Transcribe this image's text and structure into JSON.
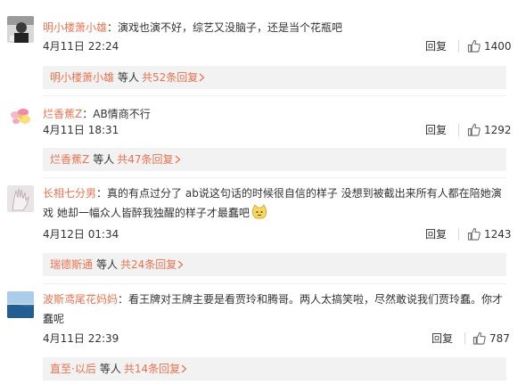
{
  "ui": {
    "reply_label": "回复",
    "others_label": "等人"
  },
  "comments": [
    {
      "avatar": "man-portrait-avatar",
      "username": "明小楼萧小雄",
      "colon": "：",
      "text": "演戏也演不好，综艺又没脑子，还是当个花瓶吧",
      "time": "4月11日 22:24",
      "likes": "1400",
      "sub_user": "明小楼萧小雄",
      "sub_count": "共52条回复"
    },
    {
      "avatar": "flower-avatar",
      "username": "烂香蕉Z",
      "colon": "：",
      "text": "AB情商不行",
      "time": "4月11日 18:31",
      "likes": "1292",
      "sub_user": "烂香蕉Z",
      "sub_count": "共47条回复"
    },
    {
      "avatar": "hand-avatar",
      "username": "长相七分男",
      "colon": "：",
      "text_line1": "真的有点过分了  ab说这句话的时候很自信的样子 没想到被截出来所有人都在陪她演",
      "text_line2": "戏 她却一幅众人皆醉我独醒的样子才最蠢吧",
      "emoji": "cat-face-emoji",
      "time": "4月12日 01:34",
      "likes": "1243",
      "sub_user": "瑞德斯通",
      "sub_count": "共24条回复"
    },
    {
      "avatar": "sea-avatar",
      "username": "波斯鸢尾花妈妈",
      "colon": "：",
      "text_line1": "看王牌对王牌主要是看贾玲和腾哥。两人太搞笑啦，尽然敢说我们贾玲蠢。你才",
      "text_line2": "蠢呢",
      "time": "4月11日 22:39",
      "likes": "787",
      "sub_user": "直至·以后",
      "sub_count": "共14条回复"
    }
  ],
  "colors": {
    "link": "#eb7350",
    "text": "#333333",
    "sub_bar_bg": "#f2f2f2"
  }
}
